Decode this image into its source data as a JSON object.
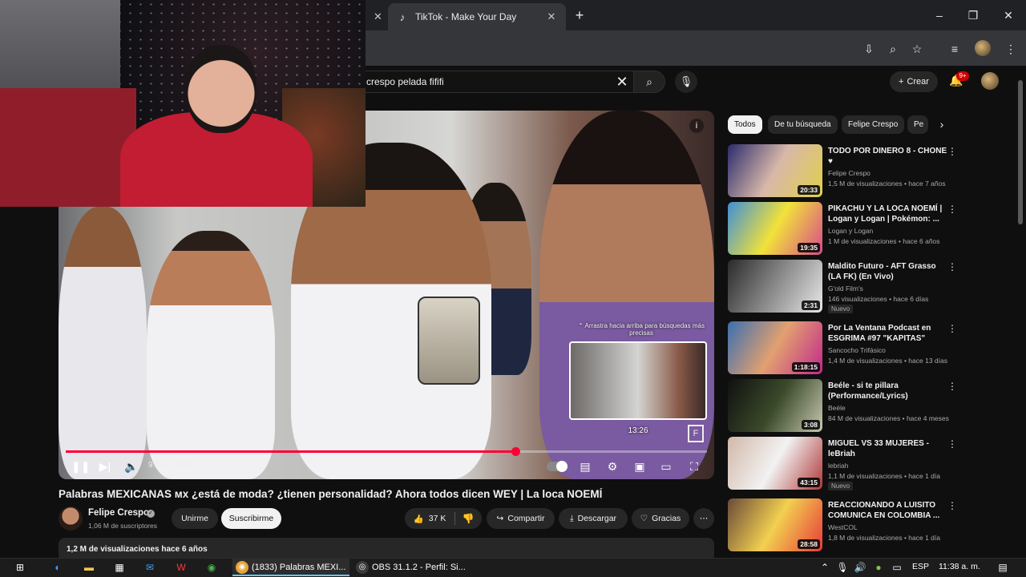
{
  "browser": {
    "tabs": [
      {
        "title": "",
        "close": "✕"
      },
      {
        "title": "TikTok - Make Your Day",
        "close": "✕"
      }
    ],
    "new_tab": "+",
    "window_controls": {
      "minimize": "–",
      "maximize": "❐",
      "close": "✕"
    }
  },
  "youtube": {
    "search": {
      "query": "crespo pelada fififi",
      "clear": "✕"
    },
    "create_label": "Crear",
    "notifications_badge": "9+"
  },
  "player": {
    "swipe_hint": "⌃ Arrastra hacia arriba para búsquedas más precisas",
    "preview_time": "13:26",
    "time_display": "9:56 / 14:10",
    "progress": 0.701,
    "preview_position": 0.955,
    "accent_color": "#ff0033"
  },
  "video": {
    "title": "Palabras MEXICANAS ᴍx ¿está de moda? ¿tienen personalidad? Ahora todos dicen WEY | La loca NOEMÍ",
    "channel": "Felipe Crespo",
    "subscribers": "1,06 M de suscriptores",
    "join_label": "Unirme",
    "subscribe_label": "Suscribirme",
    "likes": "37 K",
    "share_label": "Compartir",
    "download_label": "Descargar",
    "thanks_label": "Gracias",
    "views_date": "1,2 M de visualizaciones  hace 6 años"
  },
  "sidebar": {
    "chips": [
      "Todos",
      "De tu búsqueda",
      "Felipe Crespo",
      "Pe"
    ],
    "recommendations": [
      {
        "title": "TODO POR DINERO 8 - CHONE ♥",
        "channel": "Felipe Crespo",
        "meta": "1,5 M de visualizaciones • hace 7 años",
        "duration": "20:33",
        "badge": "",
        "thumb": [
          "#2b2b6e",
          "#d8b8a8",
          "#e0d04a"
        ]
      },
      {
        "title": "PIKACHU Y LA LOCA NOEMÍ | Logan y Logan | Pokémon: ...",
        "channel": "Logan y Logan",
        "meta": "1 M de visualizaciones • hace 6 años",
        "duration": "19:35",
        "badge": "",
        "thumb": [
          "#3f8fd8",
          "#f2e23a",
          "#d84a8a"
        ]
      },
      {
        "title": "Maldito Futuro - AFT Grasso (LA FK) (En Vivo)",
        "channel": "G'old Film's",
        "meta": "146 visualizaciones • hace 6 días",
        "duration": "2:31",
        "badge": "Nuevo",
        "thumb": [
          "#2a2a2a",
          "#8a8a8a",
          "#e8e8e8"
        ]
      },
      {
        "title": "Por La Ventana Podcast en ESGRIMA #97 \"KAPITAS\"",
        "channel": "Sancocho Trifásico",
        "meta": "1,4 M de visualizaciones • hace 13 días",
        "duration": "1:18:15",
        "badge": "",
        "thumb": [
          "#3a6fb0",
          "#e2a070",
          "#c2288a"
        ]
      },
      {
        "title": "Beéle - si te pillara (Performance/Lyrics)",
        "channel": "Beéle",
        "meta": "84 M de visualizaciones • hace 4 meses",
        "duration": "3:08",
        "badge": "",
        "thumb": [
          "#101010",
          "#3a4a2a",
          "#c8c8b0"
        ]
      },
      {
        "title": "MIGUEL VS 33 MUJERES - leBriah",
        "channel": "lebriah",
        "meta": "1,1 M de visualizaciones • hace 1 día",
        "duration": "43:15",
        "badge": "Nuevo",
        "thumb": [
          "#d2b8a8",
          "#f2f2f2",
          "#b03838"
        ]
      },
      {
        "title": "REACCIONANDO A LUISITO COMUNICA EN COLOMBIA ...",
        "channel": "WestCOL",
        "meta": "1,8 M de visualizaciones • hace 1 día",
        "duration": "28:58",
        "badge": "",
        "thumb": [
          "#6a4a3a",
          "#f2d050",
          "#e83a3a"
        ]
      }
    ]
  },
  "taskbar": {
    "apps": [
      {
        "label": "(1833) Palabras MEXI...",
        "glyph": "◉",
        "color": "#e8a33a"
      },
      {
        "label": "OBS 31.1.2 - Perfil: Si...",
        "glyph": "◎",
        "color": "#3a3a3a"
      }
    ],
    "language": "ESP",
    "clock": "11:38 a. m."
  }
}
